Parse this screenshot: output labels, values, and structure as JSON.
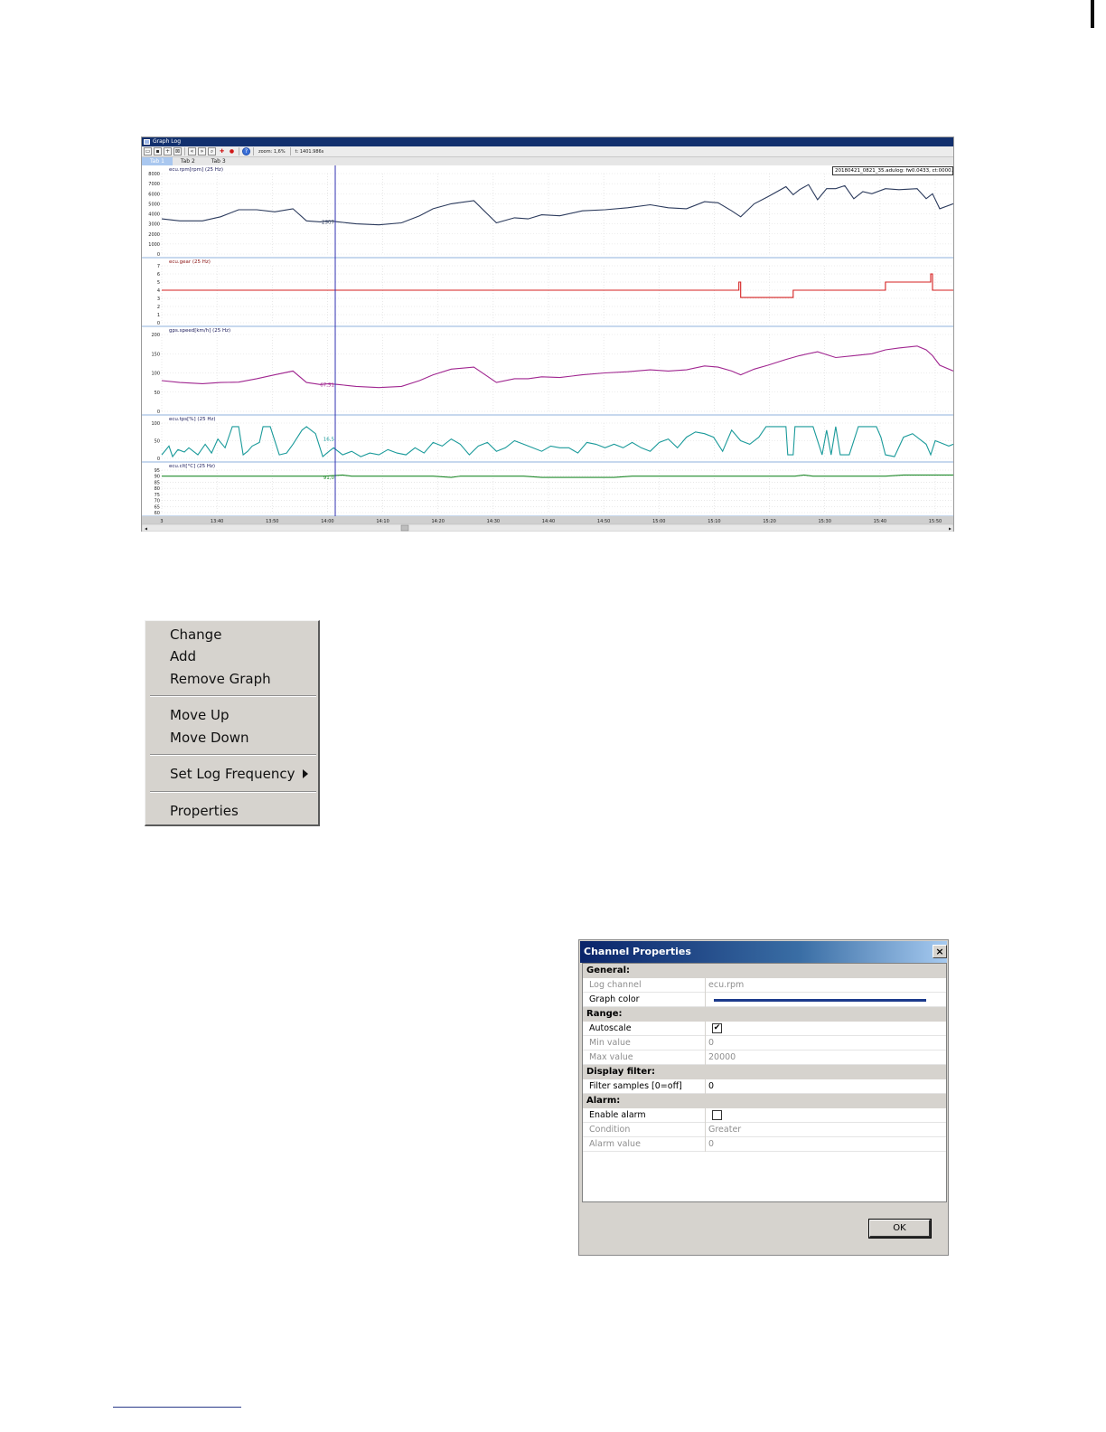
{
  "graph_window": {
    "title": "Graph Log",
    "zoom_text": "zoom: 1,6%",
    "time_text": "t: 1401.986s",
    "tabs": [
      {
        "label": "Tab 1"
      },
      {
        "label": "Tab 2"
      },
      {
        "label": "Tab 3"
      }
    ],
    "file_label": "20180421_0821_35.adulog: fw0.0433, ct:0000.0",
    "x_ticks": [
      "3",
      "13:40",
      "13:50",
      "14:00",
      "14:10",
      "14:20",
      "14:30",
      "14:40",
      "14:50",
      "15:00",
      "15:10",
      "15:20",
      "15:30",
      "15:40",
      "15:50"
    ],
    "colors": {
      "rpm": "#2b3a5c",
      "gear": "#d42020",
      "speed": "#a02690",
      "tps": "#1a9a9a",
      "clt": "#1f8a2a",
      "cursor": "#3030b0"
    }
  },
  "chart_data": [
    {
      "type": "line",
      "title": "ecu.rpm[rpm] (25 Hz)",
      "y_ticks": [
        "8000",
        "7000",
        "6000",
        "5000",
        "4000",
        "3000",
        "2000",
        "1000",
        "0"
      ],
      "ylim": [
        0,
        8000
      ],
      "cursor_value": "2907",
      "x": [
        0,
        20,
        45,
        65,
        85,
        105,
        125,
        145,
        160,
        175,
        185,
        195,
        215,
        240,
        265,
        285,
        300,
        320,
        345,
        370,
        390,
        405,
        420,
        440,
        465,
        490,
        515,
        540,
        560,
        580,
        600,
        615,
        630,
        640,
        655,
        670,
        690,
        698,
        705,
        715,
        725,
        735,
        745,
        755,
        765,
        775,
        785,
        800,
        815,
        835,
        845,
        852,
        860,
        875
      ],
      "values": [
        3500,
        3300,
        3300,
        3700,
        4400,
        4400,
        4200,
        4500,
        3300,
        3200,
        3300,
        3200,
        3000,
        2900,
        3100,
        3800,
        4500,
        5000,
        5300,
        3100,
        3600,
        3500,
        3900,
        3800,
        4300,
        4400,
        4600,
        4900,
        4600,
        4500,
        5200,
        5100,
        4300,
        3700,
        5000,
        5700,
        6700,
        5900,
        6400,
        6900,
        5400,
        6500,
        6500,
        6800,
        5500,
        6200,
        6000,
        6500,
        6400,
        6500,
        5500,
        6000,
        4500,
        5000
      ]
    },
    {
      "type": "line",
      "title": "ecu.gear (25 Hz)",
      "y_ticks": [
        "7",
        "6",
        "5",
        "4",
        "3",
        "2",
        "1",
        "0"
      ],
      "ylim": [
        0,
        7
      ],
      "x": [
        0,
        638,
        638,
        640,
        640,
        698,
        698,
        800,
        800,
        850,
        850,
        852,
        852,
        875
      ],
      "values": [
        4,
        4,
        5,
        5,
        3.1,
        3.1,
        4,
        4,
        5,
        5,
        6,
        6,
        4,
        4
      ]
    },
    {
      "type": "line",
      "title": "gps.speed[km/h] (25 Hz)",
      "y_ticks": [
        "200",
        "150",
        "100",
        "50",
        "0"
      ],
      "ylim": [
        0,
        200
      ],
      "cursor_value": "67,51",
      "x": [
        0,
        20,
        45,
        65,
        85,
        105,
        125,
        145,
        160,
        175,
        185,
        195,
        215,
        240,
        265,
        285,
        300,
        320,
        345,
        370,
        390,
        405,
        420,
        440,
        465,
        490,
        515,
        540,
        560,
        580,
        600,
        615,
        630,
        640,
        655,
        670,
        690,
        705,
        725,
        745,
        765,
        785,
        800,
        815,
        835,
        845,
        852,
        860,
        875
      ],
      "values": [
        80,
        75,
        72,
        75,
        76,
        85,
        95,
        105,
        75,
        70,
        72,
        70,
        65,
        62,
        65,
        80,
        95,
        110,
        115,
        75,
        85,
        85,
        90,
        88,
        95,
        100,
        103,
        108,
        105,
        108,
        118,
        115,
        105,
        95,
        110,
        120,
        135,
        145,
        155,
        140,
        145,
        150,
        160,
        165,
        170,
        160,
        145,
        120,
        105
      ]
    },
    {
      "type": "line",
      "title": "ecu.tps[%] (25 Hz)",
      "y_ticks": [
        "100",
        "50",
        "0"
      ],
      "ylim": [
        0,
        100
      ],
      "cursor_value": "16,5",
      "x": [
        0,
        8,
        12,
        18,
        25,
        30,
        40,
        48,
        55,
        62,
        70,
        78,
        85,
        90,
        95,
        100,
        108,
        112,
        120,
        130,
        138,
        145,
        155,
        160,
        170,
        178,
        185,
        190,
        200,
        210,
        220,
        230,
        240,
        250,
        260,
        270,
        280,
        290,
        300,
        310,
        320,
        330,
        340,
        350,
        360,
        370,
        380,
        390,
        400,
        410,
        420,
        430,
        440,
        450,
        460,
        470,
        480,
        490,
        500,
        510,
        520,
        530,
        540,
        550,
        560,
        570,
        580,
        590,
        600,
        610,
        620,
        630,
        640,
        650,
        660,
        668,
        670,
        690,
        692,
        698,
        700,
        720,
        730,
        735,
        740,
        745,
        750,
        760,
        770,
        790,
        795,
        800,
        810,
        820,
        830,
        845,
        850,
        855,
        860,
        870,
        875
      ],
      "values": [
        10,
        35,
        5,
        25,
        18,
        30,
        10,
        40,
        15,
        55,
        30,
        90,
        90,
        10,
        20,
        35,
        45,
        90,
        90,
        10,
        15,
        40,
        80,
        90,
        70,
        5,
        20,
        30,
        10,
        20,
        5,
        15,
        10,
        25,
        15,
        10,
        30,
        15,
        45,
        35,
        55,
        40,
        10,
        35,
        45,
        20,
        30,
        50,
        40,
        30,
        20,
        35,
        30,
        30,
        15,
        45,
        40,
        30,
        40,
        30,
        45,
        30,
        20,
        45,
        55,
        30,
        60,
        75,
        70,
        60,
        20,
        80,
        50,
        40,
        60,
        90,
        90,
        90,
        10,
        10,
        90,
        90,
        10,
        80,
        10,
        90,
        10,
        10,
        90,
        90,
        60,
        10,
        5,
        60,
        70,
        40,
        10,
        50,
        45,
        35,
        40
      ]
    },
    {
      "type": "line",
      "title": "ecu.clt[°C] (25 Hz)",
      "y_ticks": [
        "95",
        "90",
        "85",
        "80",
        "75",
        "70",
        "65",
        "60"
      ],
      "ylim": [
        60,
        95
      ],
      "cursor_value": "91,0",
      "x": [
        0,
        100,
        180,
        200,
        210,
        300,
        320,
        330,
        400,
        420,
        500,
        520,
        600,
        700,
        710,
        720,
        800,
        820,
        875
      ],
      "values": [
        90,
        90,
        90,
        91,
        90,
        90,
        89,
        90,
        90,
        89,
        89,
        90,
        90,
        90,
        91,
        90,
        90,
        91,
        91
      ]
    }
  ],
  "context_menu": {
    "items": [
      {
        "label": "Change"
      },
      {
        "label": "Add"
      },
      {
        "label": "Remove Graph"
      },
      {
        "label": "Move Up"
      },
      {
        "label": "Move Down"
      },
      {
        "label": "Set Log Frequency"
      },
      {
        "label": "Properties"
      }
    ]
  },
  "dialog": {
    "title": "Channel Properties",
    "close_label": "×",
    "categories": {
      "general": "General:",
      "range": "Range:",
      "display": "Display filter:",
      "alarm": "Alarm:"
    },
    "rows": {
      "log_channel": {
        "name": "Log channel",
        "value": "ecu.rpm"
      },
      "graph_color": {
        "name": "Graph color",
        "color": "#1c3a8c"
      },
      "autoscale": {
        "name": "Autoscale",
        "checked": "✔"
      },
      "min_value": {
        "name": "Min value",
        "value": "0"
      },
      "max_value": {
        "name": "Max value",
        "value": "20000"
      },
      "filter_samples": {
        "name": "Filter samples [0=off]",
        "value": "0"
      },
      "enable_alarm": {
        "name": "Enable alarm",
        "checked": ""
      },
      "condition": {
        "name": "Condition",
        "value": "Greater"
      },
      "alarm_value": {
        "name": "Alarm value",
        "value": "0"
      }
    },
    "ok_label": "OK"
  }
}
